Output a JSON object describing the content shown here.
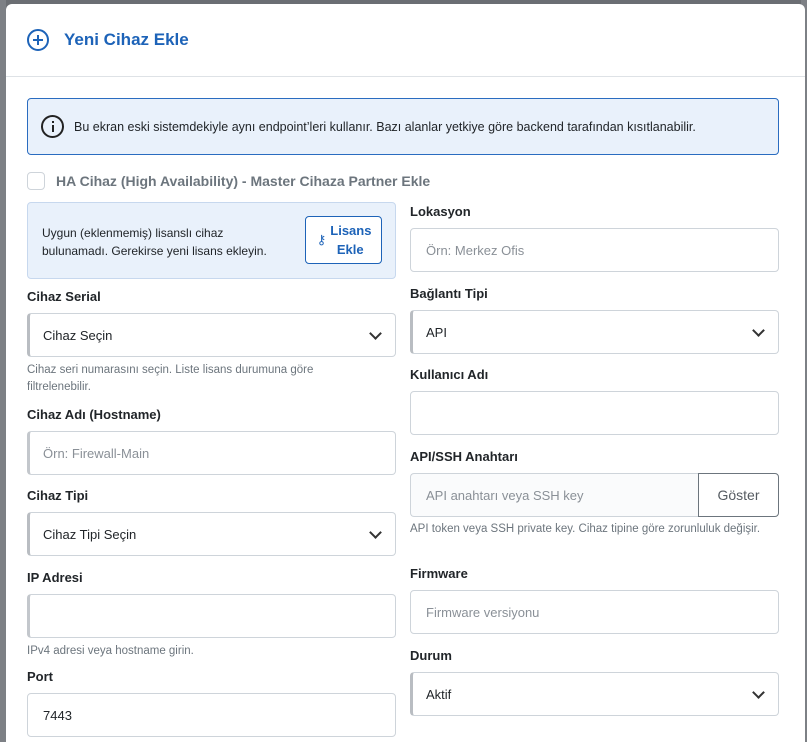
{
  "header": {
    "title": "Yeni Cihaz Ekle"
  },
  "info_alert": {
    "text": "Bu ekran eski sistemdekiyle aynı endpoint’leri kullanır. Bazı alanlar yetkiye göre backend tarafından kısıtlanabilir."
  },
  "ha_checkbox": {
    "label": "HA Cihaz (High Availability) - Master Cihaza Partner Ekle",
    "checked": false
  },
  "license_notice": {
    "text": "Uygun (eklenmemiş) lisanslı cihaz bulunamadı. Gerekirse yeni lisans ekleyin.",
    "button_label": "Lisans Ekle"
  },
  "left": {
    "serial": {
      "label": "Cihaz Serial",
      "value": "Cihaz Seçin",
      "help": "Cihaz seri numarasını seçin. Liste lisans durumuna göre filtrelenebilir."
    },
    "hostname": {
      "label": "Cihaz Adı (Hostname)",
      "placeholder": "Örn: Firewall-Main"
    },
    "type": {
      "label": "Cihaz Tipi",
      "value": "Cihaz Tipi Seçin"
    },
    "ip": {
      "label": "IP Adresi",
      "value": "",
      "help": "IPv4 adresi veya hostname girin."
    },
    "port": {
      "label": "Port",
      "value": "7443"
    }
  },
  "right": {
    "location": {
      "label": "Lokasyon",
      "placeholder": "Örn: Merkez Ofis"
    },
    "connection": {
      "label": "Bağlantı Tipi",
      "value": "API"
    },
    "username": {
      "label": "Kullanıcı Adı",
      "value": ""
    },
    "key": {
      "label": "API/SSH Anahtarı",
      "placeholder": "API anahtarı veya SSH key",
      "show_label": "Göster",
      "help": "API token veya SSH private key. Cihaz tipine göre zorunluluk değişir."
    },
    "firmware": {
      "label": "Firmware",
      "placeholder": "Firmware versiyonu"
    },
    "status": {
      "label": "Durum",
      "value": "Aktif"
    }
  }
}
